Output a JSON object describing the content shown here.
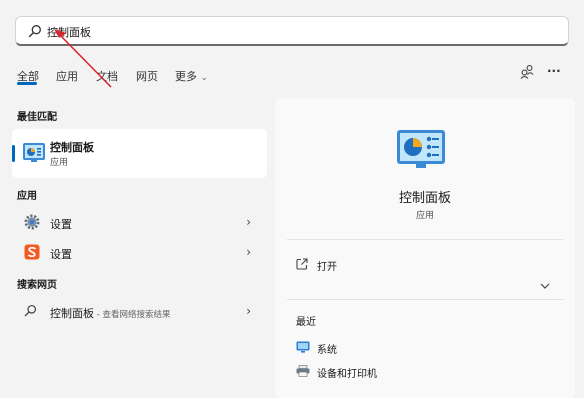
{
  "search": {
    "query": "控制面板"
  },
  "tabs": [
    {
      "label": "全部"
    },
    {
      "label": "应用"
    },
    {
      "label": "文档"
    },
    {
      "label": "网页"
    },
    {
      "label": "更多"
    }
  ],
  "more_chevron": "⌄",
  "top_actions": {
    "more": "···"
  },
  "best_match": {
    "heading": "最佳匹配",
    "title": "控制面板",
    "subtitle": "应用"
  },
  "apps": {
    "heading": "应用",
    "items": [
      {
        "label": "设置",
        "chevron": "›"
      },
      {
        "label": "设置",
        "chevron": "›"
      }
    ]
  },
  "web": {
    "heading": "搜索网页",
    "item": {
      "label": "控制面板",
      "suffix": " - 查看网络搜索结果",
      "chevron": "›"
    }
  },
  "detail": {
    "title": "控制面板",
    "subtitle": "应用",
    "open_label": "打开",
    "recent_heading": "最近",
    "recent_items": [
      {
        "label": "系统"
      },
      {
        "label": "设备和打印机"
      }
    ]
  },
  "colors": {
    "accent": "#0067c0",
    "arrow": "#d9272e"
  }
}
